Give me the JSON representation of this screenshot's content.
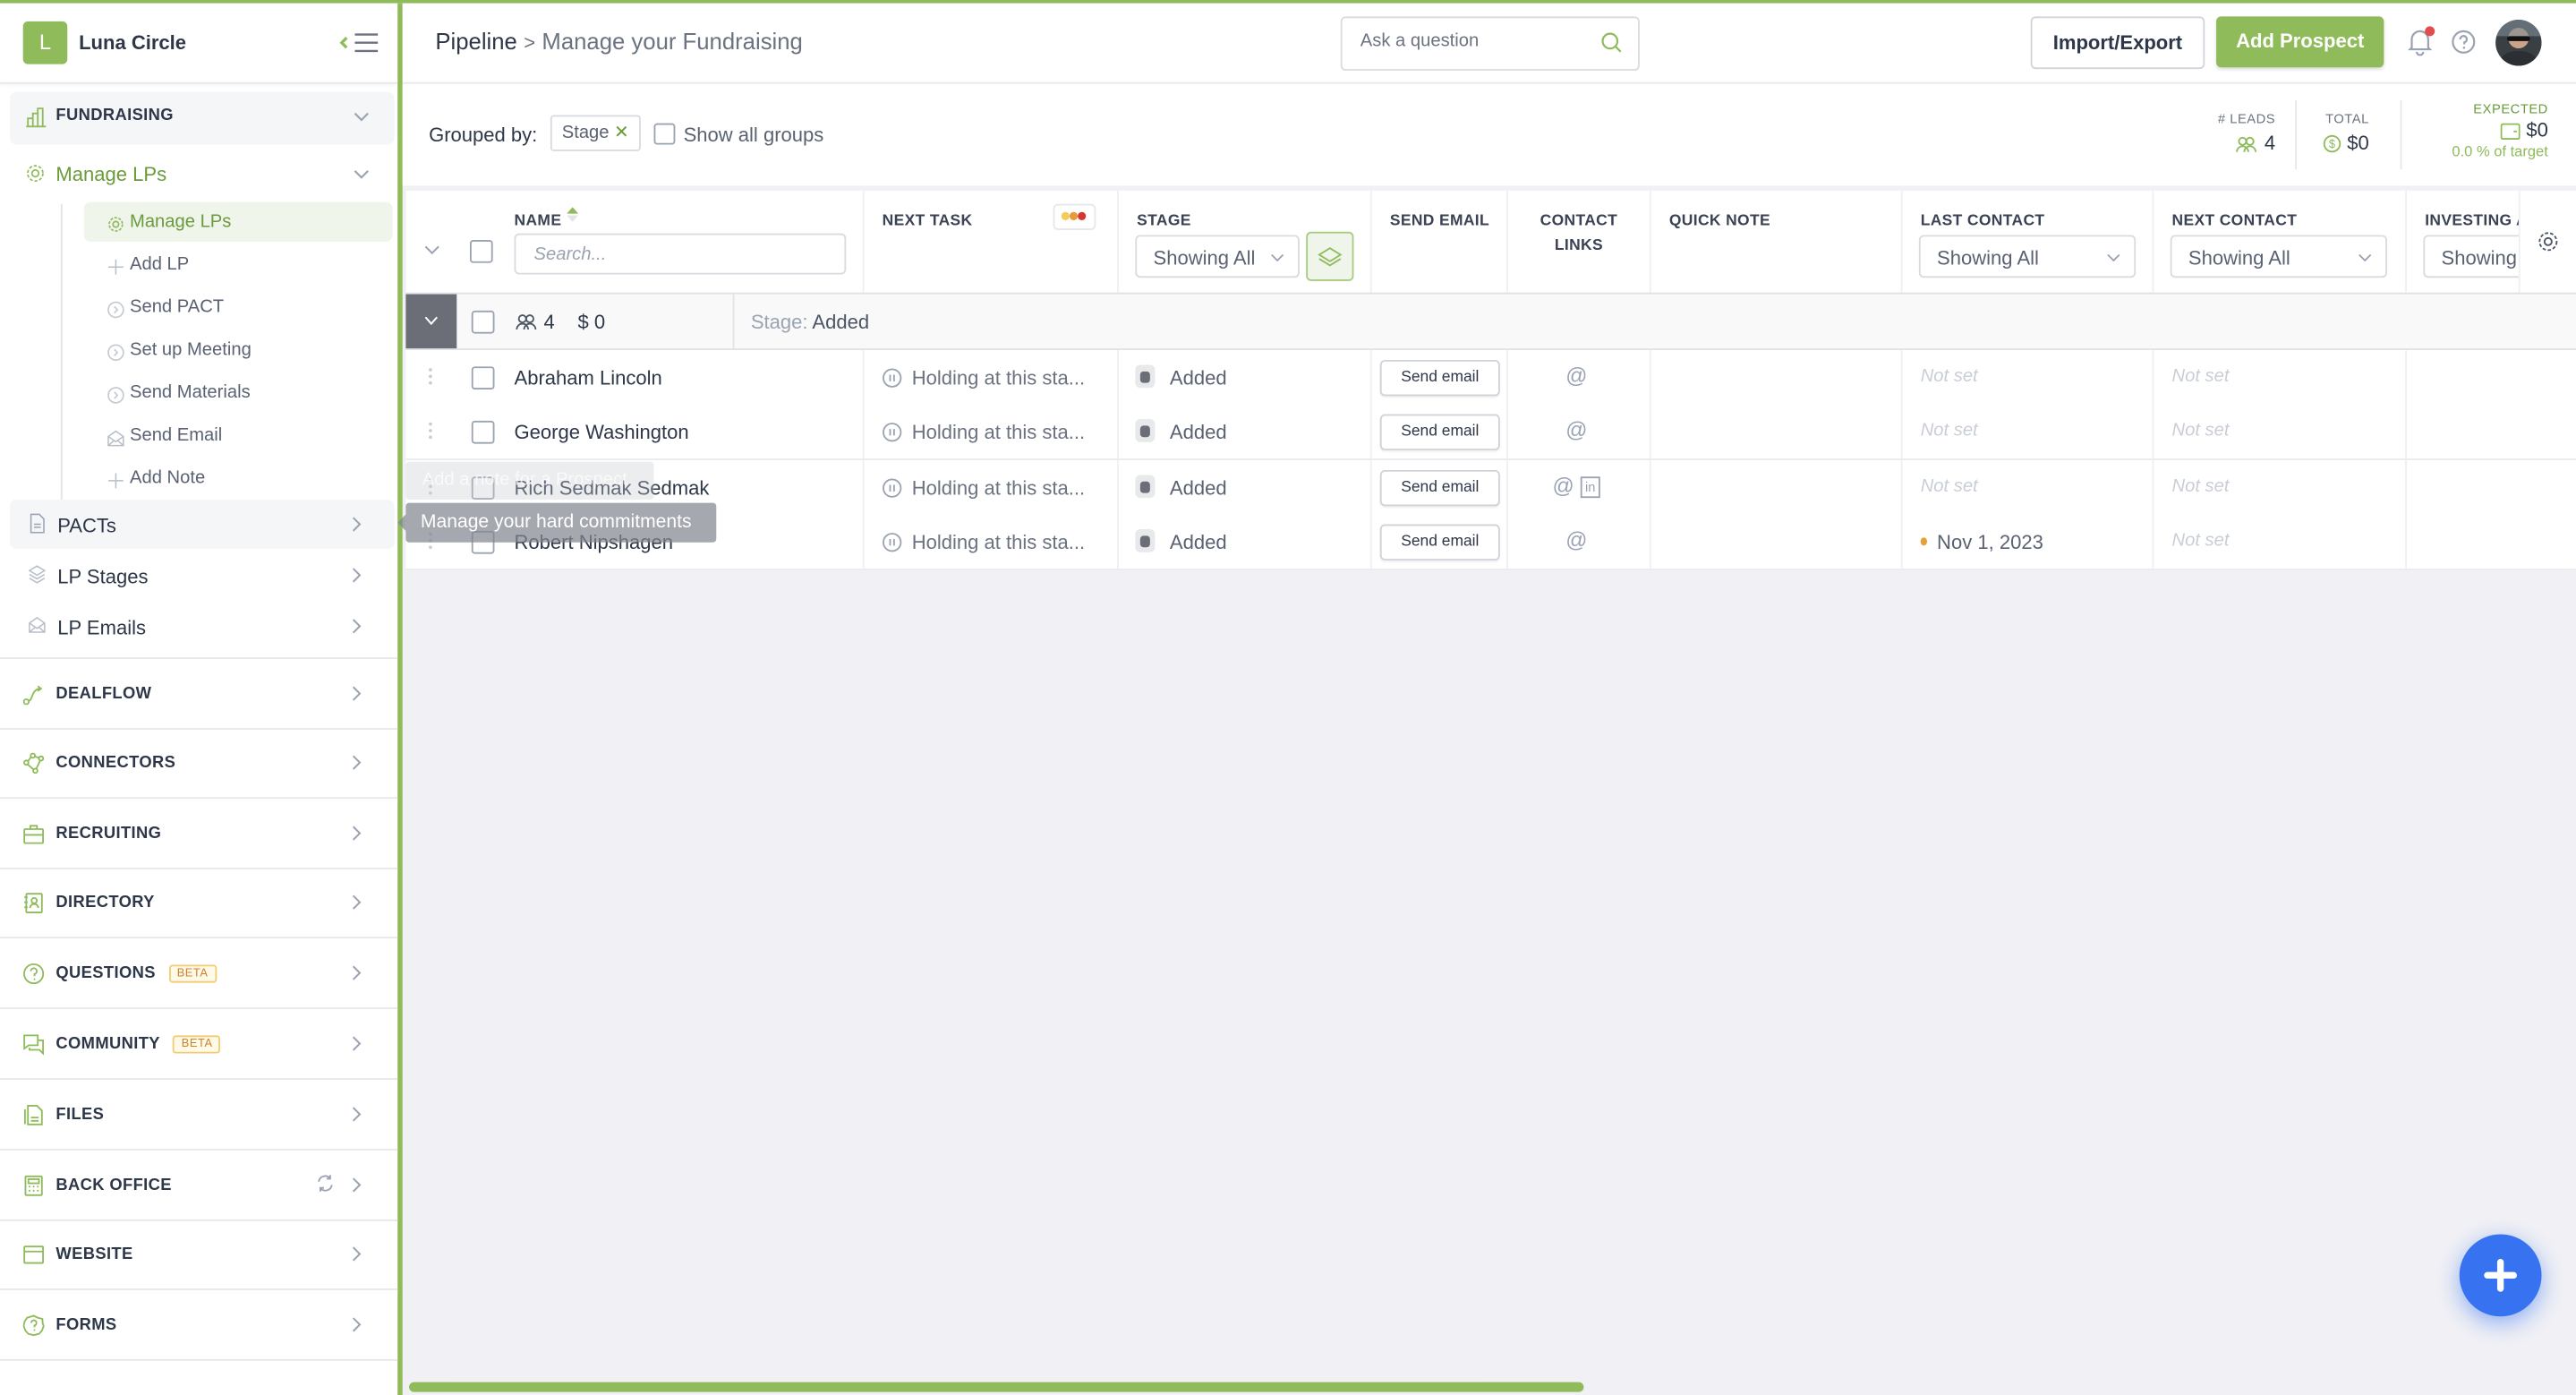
{
  "brand": {
    "initial": "L",
    "name": "Luna Circle"
  },
  "sidebar": {
    "fundraising": {
      "label": "FUNDRAISING"
    },
    "manage_lps": {
      "label": "Manage LPs"
    },
    "sub_items": [
      {
        "label": "Manage LPs",
        "icon": "gear-icon",
        "active": true
      },
      {
        "label": "Add LP",
        "icon": "plus-icon"
      },
      {
        "label": "Send PACT",
        "icon": "chevron-circle-icon"
      },
      {
        "label": "Set up Meeting",
        "icon": "chevron-circle-icon"
      },
      {
        "label": "Send Materials",
        "icon": "chevron-circle-icon"
      },
      {
        "label": "Send Email",
        "icon": "envelope-open-icon"
      },
      {
        "label": "Add Note",
        "icon": "plus-icon"
      }
    ],
    "level2": [
      {
        "label": "PACTs",
        "icon": "document-icon"
      },
      {
        "label": "LP Stages",
        "icon": "layers-icon"
      },
      {
        "label": "LP Emails",
        "icon": "envelope-open-icon"
      }
    ],
    "sections": [
      {
        "label": "DEALFLOW",
        "icon": "route-icon"
      },
      {
        "label": "CONNECTORS",
        "icon": "network-icon"
      },
      {
        "label": "RECRUITING",
        "icon": "briefcase-icon"
      },
      {
        "label": "DIRECTORY",
        "icon": "contact-book-icon"
      },
      {
        "label": "QUESTIONS",
        "icon": "question-circle-icon",
        "badge": "BETA"
      },
      {
        "label": "COMMUNITY",
        "icon": "chat-icon",
        "badge": "BETA"
      },
      {
        "label": "FILES",
        "icon": "files-icon"
      },
      {
        "label": "BACK OFFICE",
        "icon": "calculator-icon",
        "extra_icon": "sync-icon"
      },
      {
        "label": "WEBSITE",
        "icon": "browser-icon"
      },
      {
        "label": "FORMS",
        "icon": "form-badge-icon"
      }
    ]
  },
  "header": {
    "breadcrumb_root": "Pipeline",
    "breadcrumb_current": "Manage your Fundraising",
    "ask_placeholder": "Ask a question",
    "import_export": "Import/Export",
    "add_prospect": "Add Prospect"
  },
  "toolbar": {
    "grouped_by_label": "Grouped by:",
    "group_chip": "Stage",
    "show_all_groups": "Show all groups",
    "stats": {
      "leads_label": "# LEADS",
      "leads_value": "4",
      "total_label": "TOTAL",
      "total_value": "$0",
      "expected_label": "EXPECTED",
      "expected_value": "$0",
      "expected_sub": "0.0 % of target"
    }
  },
  "table": {
    "columns": {
      "name": "NAME",
      "next_task": "NEXT TASK",
      "stage": "STAGE",
      "send_email": "SEND EMAIL",
      "contact_links": "CONTACT LINKS",
      "quick_note": "QUICK NOTE",
      "last_contact": "LAST CONTACT",
      "next_contact": "NEXT CONTACT",
      "investing": "INVESTING A"
    },
    "search_placeholder": "Search...",
    "filter_showing_all": "Showing All",
    "filter_showing_truncated": "Showing",
    "group": {
      "count": "4",
      "amount": "$ 0",
      "stage_label": "Stage:",
      "stage_value": "Added"
    },
    "rows": [
      {
        "name": "Abraham Lincoln",
        "next_task": "Holding at this sta...",
        "stage": "Added",
        "send_email": "Send email",
        "links": [
          "email"
        ],
        "last_contact": "Not set",
        "next_contact": "Not set"
      },
      {
        "name": "George Washington",
        "next_task": "Holding at this sta...",
        "stage": "Added",
        "send_email": "Send email",
        "links": [
          "email"
        ],
        "last_contact": "Not set",
        "next_contact": "Not set"
      },
      {
        "name": "Rich Sedmak Sedmak",
        "next_task": "Holding at this sta...",
        "stage": "Added",
        "send_email": "Send email",
        "links": [
          "email",
          "linkedin"
        ],
        "last_contact": "Not set",
        "next_contact": "Not set"
      },
      {
        "name": "Robert Nipshagen",
        "next_task": "Holding at this sta...",
        "stage": "Added",
        "send_email": "Send email",
        "links": [
          "email"
        ],
        "last_contact": "Nov 1, 2023",
        "next_contact": "Not set"
      }
    ]
  },
  "tooltips": {
    "faded": "Add a note for a Prospect",
    "active": "Manage your hard commitments"
  },
  "linkedin_glyph": "in",
  "at_glyph": "@",
  "scroll": {
    "horizontal_visible_fraction": 0.55
  },
  "colors": {
    "brand_green": "#8fbb5a",
    "fab_blue": "#3773f0",
    "notification_red": "#e24c4c",
    "beta_orange": "#c9832f"
  }
}
